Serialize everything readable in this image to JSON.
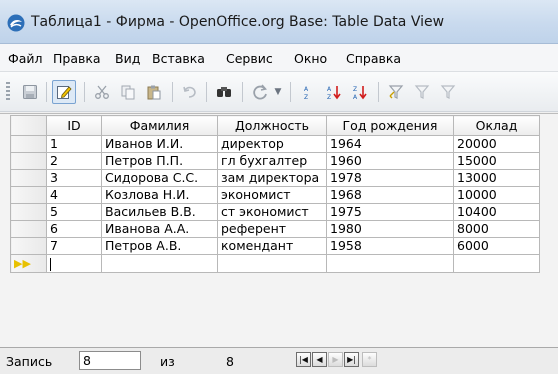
{
  "window": {
    "title": "Таблица1 - Фирма - OpenOffice.org Base: Table Data View"
  },
  "menu": {
    "items": [
      "Файл",
      "Правка",
      "Вид",
      "Вставка",
      "Сервис",
      "Окно",
      "Справка"
    ]
  },
  "toolbar": {
    "buttons": [
      "save-icon",
      "edit-icon",
      "cut-icon",
      "copy-icon",
      "paste-icon",
      "undo-icon",
      "find-icon",
      "refresh-icon",
      "sort-ascending-icon",
      "sort-a-z-icon",
      "sort-z-a-icon",
      "autofilter-icon",
      "standard-filter-icon",
      "filter-icon"
    ]
  },
  "table": {
    "columns": [
      "ID",
      "Фамилия",
      "Должность",
      "Год рождения",
      "Оклад"
    ],
    "rows": [
      [
        "1",
        "Иванов И.И.",
        "директор",
        "1964",
        "20000"
      ],
      [
        "2",
        "Петров П.П.",
        "гл бухгалтер",
        "1960",
        "15000"
      ],
      [
        "3",
        "Сидорова С.С.",
        "зам директора",
        "1978",
        "13000"
      ],
      [
        "4",
        "Козлова Н.И.",
        "экономист",
        "1968",
        "10000"
      ],
      [
        "5",
        "Васильев В.В.",
        "ст экономист",
        "1975",
        "10400"
      ],
      [
        "6",
        "Иванова А.А.",
        "референт",
        "1980",
        "8000"
      ],
      [
        "7",
        "Петров А.В.",
        "комендант",
        "1958",
        "6000"
      ]
    ],
    "new_row_marker": "▶▶"
  },
  "navigation": {
    "record_label": "Запись",
    "current_record": "8",
    "of_label": "из",
    "total_records": "8"
  }
}
